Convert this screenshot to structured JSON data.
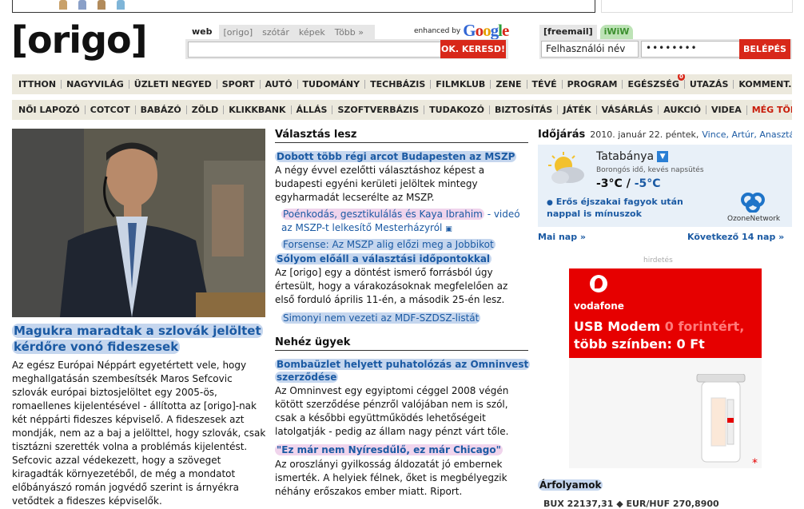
{
  "logo": "[origo]",
  "search": {
    "tabs": [
      "web",
      "[origo]",
      "szótár",
      "képek",
      "Több »"
    ],
    "enhanced_by": "enhanced by",
    "google": "Google",
    "button": "OK. KERESD!"
  },
  "mail": {
    "tabs": [
      "[freemail]",
      "iWiW"
    ],
    "user_value": "Felhasználói név",
    "pass_value": "••••••••",
    "login_button": "BELÉPÉS"
  },
  "nav1": [
    "ITTHON",
    "NAGYVILÁG",
    "ÜZLETI NEGYED",
    "SPORT",
    "AUTÓ",
    "TUDOMÁNY",
    "TECHBÁZIS",
    "FILMKLUB",
    "ZENE",
    "TÉVÉ",
    "PROGRAM",
    "EGÉSZSÉG",
    "UTAZÁS",
    "KOMMENT.HU"
  ],
  "nav1_badge": "0",
  "nav2": [
    "NŐI LAPOZÓ",
    "COTCOT",
    "BABÁZÓ",
    "ZÖLD",
    "KLIKKBANK",
    "ÁLLÁS",
    "SZOFTVERBÁZIS",
    "TUDAKOZÓ",
    "BIZTOSÍTÁS",
    "JÁTÉK",
    "VÁSÁRLÁS",
    "AUKCIÓ",
    "VIDEA"
  ],
  "nav2_more": "MÉG TÖBB",
  "main": {
    "headline": "Magukra maradtak a szlovák jelöltet kérdőre vonó fideszesek",
    "lead": "Az egész Európai Néppárt egyetértett vele, hogy meghallgatásán szembesítsék Maros Sefcovic szlovák európai biztosjelöltet egy 2005-ös, romaellenes kijelentésével - állította az [origo]-nak két néppárti fideszes képviselő. A fideszesek azt mondják, nem az a baj a jelölttel, hogy szlovák, csak tisztázni szerették volna a problémás kijelentést. Sefcovic azzal védekezett, hogy a szöveget kiragadták környezetéből, de még a mondatot előbányászó román jogvédő szerint is árnyékra vetődtek a fideszes képviselők."
  },
  "section1": {
    "title": "Választás lesz",
    "link1": "Dobott több régi arcot Budapesten az MSZP",
    "text1": "A négy évvel ezelőtti választáshoz képest a budapesti egyéni kerületi jelöltek mintegy egyharmadát lecserélte az MSZP.",
    "bullet1": "Poénkodás, gesztikulálás és Kaya Ibrahim",
    "bullet1_rest": " - videó az MSZP-t lelkesítő Mesterházyról",
    "bullet2": "Forsense: Az MSZP alig előzi meg a Jobbikot",
    "link2": "Sólyom előáll a választási időpontokkal",
    "text2": "Az [origo] egy a döntést ismerő forrásból úgy értesült, hogy a várakozásoknak megfelelően az első forduló április 11-én, a második 25-én lesz.",
    "bullet3": "Simonyi nem vezeti az MDF-SZDSZ-listát"
  },
  "section2": {
    "title": "Nehéz ügyek",
    "link1": "Bombaüzlet helyett puhatolózás az Omninvest szerződése",
    "text1": "Az Omninvest egy egyiptomi céggel 2008 végén kötött szerződése pénzről valójában nem is szól, csak a későbbi együttműködés lehetőségeit latolgatják - pedig az állam nagy pénzt várt tőle.",
    "link2": "\"Ez már nem Nyíresdűlő, ez már Chicago\"",
    "text2": "Az oroszlányi gyilkosság áldozatát jó embernek ismerték. A helyiek félnek, őket is megbélyegzik néhány erőszakos ember miatt. Riport."
  },
  "weather": {
    "title": "Időjárás",
    "date": "2010. január 22. péntek,",
    "names": "Vince, Artúr, Anasztázia",
    "city": "Tatabánya",
    "desc": "Borongós idő, kevés napsütés",
    "temp_high": "-3°C",
    "sep": " / ",
    "temp_low": "-5°C",
    "warning": "Erős éjszakai fagyok után nappal is mínuszok",
    "provider": "OzoneNetwork",
    "today_link": "Mai nap »",
    "next_link": "Következő 14 nap »"
  },
  "ad": {
    "label": "hirdetés",
    "brand": "vodafone",
    "line1": "USB Modem",
    "line1_dim": " 0 forintért,",
    "line2": "több színben: 0 Ft"
  },
  "rates": {
    "title": "Árfolyamok",
    "row": "BUX  22137,31   ◆ EUR/HUF  270,8900"
  }
}
